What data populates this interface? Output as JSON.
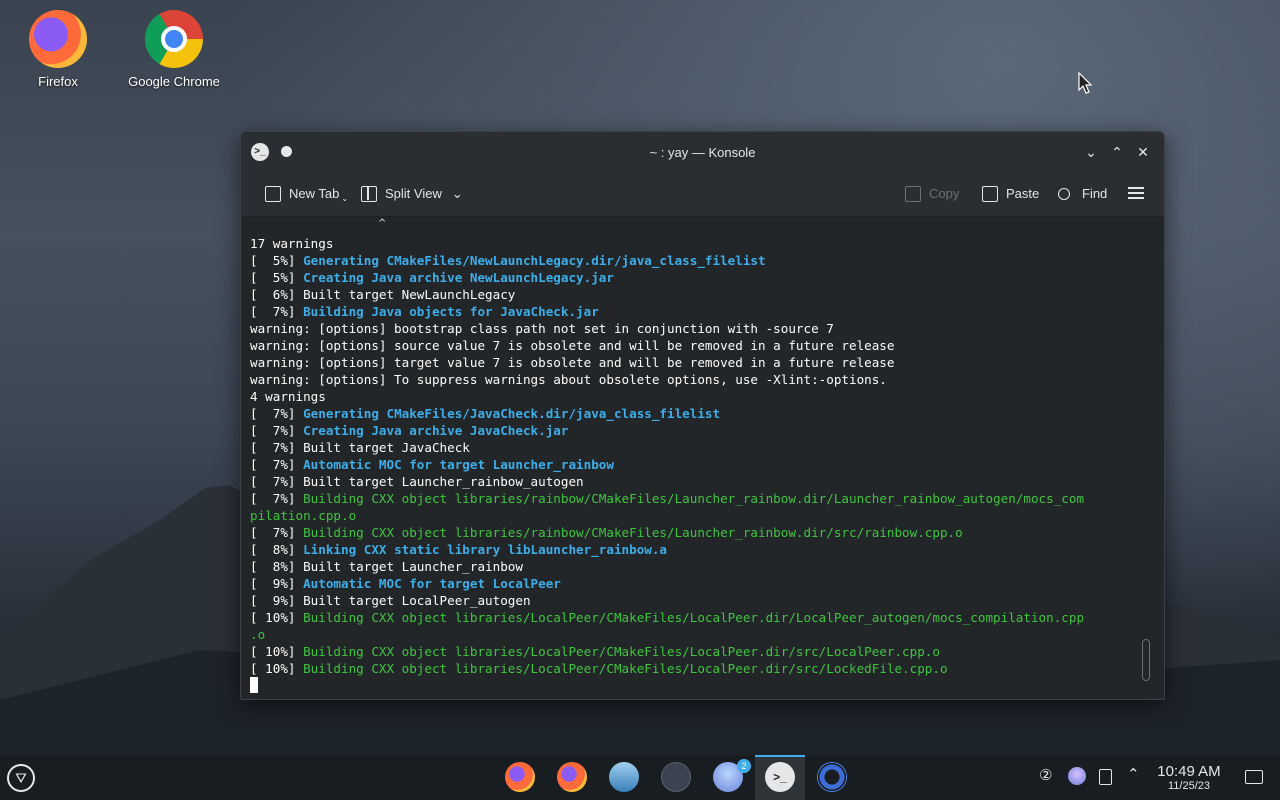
{
  "desktop": {
    "icons": [
      {
        "label": "Firefox",
        "icon": "firefox-icon"
      },
      {
        "label": "Google Chrome",
        "icon": "chrome-icon"
      }
    ]
  },
  "window": {
    "title": "~ : yay — Konsole",
    "toolbar": {
      "new_tab": "New Tab",
      "split_view": "Split View",
      "copy": "Copy",
      "paste": "Paste",
      "find": "Find"
    },
    "terminal": {
      "scroll_caret": "^",
      "lines": [
        {
          "prefix": "",
          "text": "17 warnings",
          "style": "plain"
        },
        {
          "prefix": "[  5%] ",
          "text": "Generating CMakeFiles/NewLaunchLegacy.dir/java_class_filelist",
          "style": "blue"
        },
        {
          "prefix": "[  5%] ",
          "text": "Creating Java archive NewLaunchLegacy.jar",
          "style": "blue"
        },
        {
          "prefix": "[  6%] ",
          "text": "Built target NewLaunchLegacy",
          "style": "plain"
        },
        {
          "prefix": "[  7%] ",
          "text": "Building Java objects for JavaCheck.jar",
          "style": "blue"
        },
        {
          "prefix": "",
          "text": "warning: [options] bootstrap class path not set in conjunction with -source 7",
          "style": "plain"
        },
        {
          "prefix": "",
          "text": "warning: [options] source value 7 is obsolete and will be removed in a future release",
          "style": "plain"
        },
        {
          "prefix": "",
          "text": "warning: [options] target value 7 is obsolete and will be removed in a future release",
          "style": "plain"
        },
        {
          "prefix": "",
          "text": "warning: [options] To suppress warnings about obsolete options, use -Xlint:-options.",
          "style": "plain"
        },
        {
          "prefix": "",
          "text": "4 warnings",
          "style": "plain"
        },
        {
          "prefix": "[  7%] ",
          "text": "Generating CMakeFiles/JavaCheck.dir/java_class_filelist",
          "style": "blue"
        },
        {
          "prefix": "[  7%] ",
          "text": "Creating Java archive JavaCheck.jar",
          "style": "blue"
        },
        {
          "prefix": "[  7%] ",
          "text": "Built target JavaCheck",
          "style": "plain"
        },
        {
          "prefix": "[  7%] ",
          "text": "Automatic MOC for target Launcher_rainbow",
          "style": "blue"
        },
        {
          "prefix": "[  7%] ",
          "text": "Built target Launcher_rainbow_autogen",
          "style": "plain"
        },
        {
          "prefix": "[  7%] ",
          "text": "Building CXX object libraries/rainbow/CMakeFiles/Launcher_rainbow.dir/Launcher_rainbow_autogen/mocs_com",
          "style": "green"
        },
        {
          "prefix": "",
          "text": "pilation.cpp.o",
          "style": "green"
        },
        {
          "prefix": "[  7%] ",
          "text": "Building CXX object libraries/rainbow/CMakeFiles/Launcher_rainbow.dir/src/rainbow.cpp.o",
          "style": "green"
        },
        {
          "prefix": "[  8%] ",
          "text": "Linking CXX static library libLauncher_rainbow.a",
          "style": "blue"
        },
        {
          "prefix": "[  8%] ",
          "text": "Built target Launcher_rainbow",
          "style": "plain"
        },
        {
          "prefix": "[  9%] ",
          "text": "Automatic MOC for target LocalPeer",
          "style": "blue"
        },
        {
          "prefix": "[  9%] ",
          "text": "Built target LocalPeer_autogen",
          "style": "plain"
        },
        {
          "prefix": "[ 10%] ",
          "text": "Building CXX object libraries/LocalPeer/CMakeFiles/LocalPeer.dir/LocalPeer_autogen/mocs_compilation.cpp",
          "style": "green"
        },
        {
          "prefix": "",
          "text": ".o",
          "style": "green"
        },
        {
          "prefix": "[ 10%] ",
          "text": "Building CXX object libraries/LocalPeer/CMakeFiles/LocalPeer.dir/src/LocalPeer.cpp.o",
          "style": "green"
        },
        {
          "prefix": "[ 10%] ",
          "text": "Building CXX object libraries/LocalPeer/CMakeFiles/LocalPeer.dir/src/LockedFile.cpp.o",
          "style": "green"
        }
      ]
    }
  },
  "taskbar": {
    "apps": [
      {
        "name": "firefox-icon"
      },
      {
        "name": "firefox-icon"
      },
      {
        "name": "dolphin-icon"
      },
      {
        "name": "settings-icon"
      },
      {
        "name": "discover-icon",
        "badge": "2"
      },
      {
        "name": "konsole-icon",
        "active": true
      },
      {
        "name": "chromium-icon"
      }
    ],
    "tray": {
      "status": "②"
    },
    "clock": {
      "time": "10:49 AM",
      "date": "11/25/23"
    }
  },
  "colors": {
    "terminal_bg": "#232629",
    "accent_blue": "#3daee9",
    "build_green": "#3fc43f",
    "text": "#fcfcfc"
  }
}
